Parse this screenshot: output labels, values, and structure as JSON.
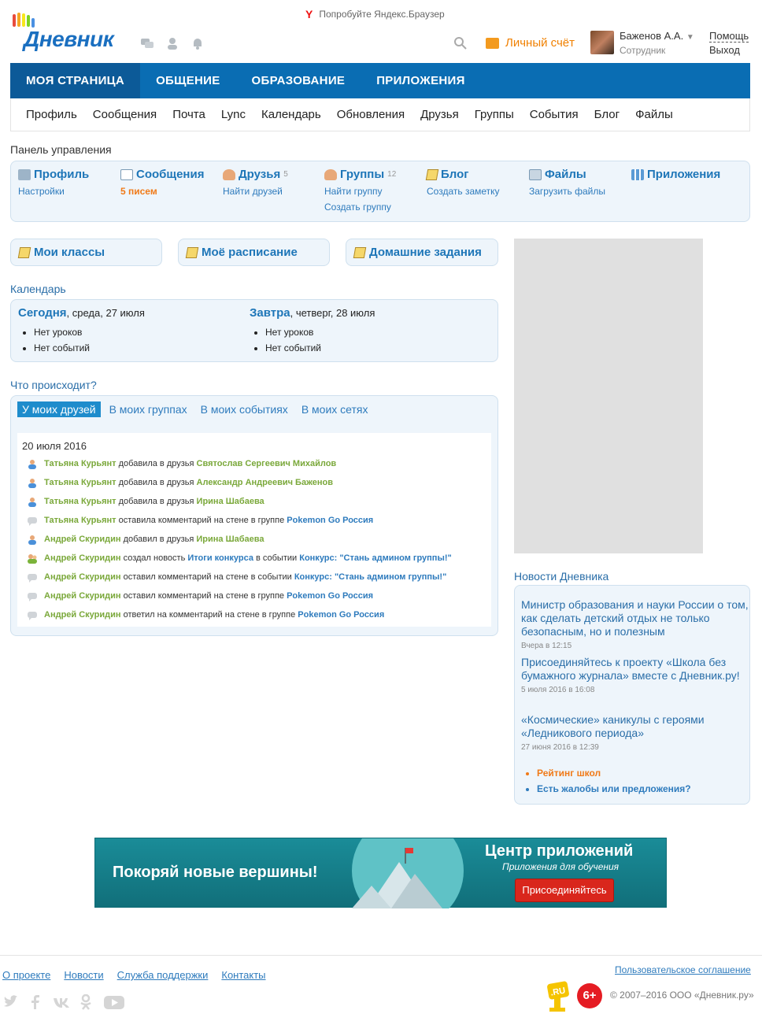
{
  "browser_promo": {
    "text": "Попробуйте Яндекс.Браузер"
  },
  "logo": {
    "text": "Дневник"
  },
  "header": {
    "account_label": "Личный счёт",
    "user_name": "Баженов А.А.",
    "user_role": "Сотрудник",
    "help": "Помощь",
    "exit": "Выход"
  },
  "main_nav": [
    "МОЯ СТРАНИЦА",
    "ОБЩЕНИЕ",
    "ОБРАЗОВАНИЕ",
    "ПРИЛОЖЕНИЯ"
  ],
  "sub_nav": [
    "Профиль",
    "Сообщения",
    "Почта",
    "Lync",
    "Календарь",
    "Обновления",
    "Друзья",
    "Группы",
    "События",
    "Блог",
    "Файлы"
  ],
  "control_panel": {
    "title": "Панель управления",
    "profile": {
      "title": "Профиль",
      "link": "Настройки"
    },
    "messages": {
      "title": "Сообщения",
      "link": "5 писем"
    },
    "friends": {
      "title": "Друзья",
      "count": "5",
      "link": "Найти друзей"
    },
    "groups": {
      "title": "Группы",
      "count": "12",
      "link1": "Найти группу",
      "link2": "Создать группу"
    },
    "blog": {
      "title": "Блог",
      "link": "Создать заметку"
    },
    "files": {
      "title": "Файлы",
      "link": "Загрузить файлы"
    },
    "apps": {
      "title": "Приложения"
    }
  },
  "quick_buttons": [
    "Мои классы",
    "Моё расписание",
    "Домашние задания"
  ],
  "calendar": {
    "title": "Календарь",
    "today": {
      "label": "Сегодня",
      "date": ", среда, 27 июля",
      "items": [
        "Нет уроков",
        "Нет событий"
      ]
    },
    "tomorrow": {
      "label": "Завтра",
      "date": ", четверг, 28 июля",
      "items": [
        "Нет уроков",
        "Нет событий"
      ]
    }
  },
  "activity": {
    "title": "Что происходит?",
    "tabs": [
      "У моих друзей",
      "В моих группах",
      "В моих событиях",
      "В моих сетях"
    ],
    "date": "20 июля 2016",
    "rows": [
      {
        "icon": "person-icon",
        "actor": "Татьяна Курьянт",
        "action": " добавила в друзья ",
        "target": "Святослав Сергеевич Михайлов",
        "extra": "",
        "target2": ""
      },
      {
        "icon": "person-icon",
        "actor": "Татьяна Курьянт",
        "action": " добавила в друзья ",
        "target": "Александр Андреевич Баженов",
        "extra": "",
        "target2": ""
      },
      {
        "icon": "person-icon",
        "actor": "Татьяна Курьянт",
        "action": " добавила в друзья ",
        "target": "Ирина Шабаева",
        "extra": "",
        "target2": ""
      },
      {
        "icon": "comment-icon",
        "actor": "Татьяна Курьянт",
        "action": " оставила комментарий на стене в группе ",
        "target": "Pokemon Go Россия",
        "extra": "",
        "target2": ""
      },
      {
        "icon": "person-icon",
        "actor": "Андрей Скуридин",
        "action": " добавил в друзья ",
        "target": "Ирина Шабаева",
        "extra": "",
        "target2": ""
      },
      {
        "icon": "group-icon",
        "actor": "Андрей Скуридин",
        "action": " создал новость ",
        "target": "Итоги конкурса",
        "extra": " в событии ",
        "target2": "Конкурс: \"Стань админом группы!\""
      },
      {
        "icon": "comment-icon",
        "actor": "Андрей Скуридин",
        "action": " оставил комментарий на стене в событии ",
        "target": "Конкурс: \"Стань админом группы!\"",
        "extra": "",
        "target2": ""
      },
      {
        "icon": "comment-icon",
        "actor": "Андрей Скуридин",
        "action": " оставил комментарий на стене в группе ",
        "target": "Pokemon Go Россия",
        "extra": "",
        "target2": ""
      },
      {
        "icon": "comment-icon",
        "actor": "Андрей Скуридин",
        "action": " ответил на комментарий на стене в группе ",
        "target": "Pokemon Go Россия",
        "extra": "",
        "target2": ""
      }
    ]
  },
  "news": {
    "title": "Новости Дневника",
    "items": [
      {
        "text": "Министр образования и науки России о том, как сделать детский отдых не только безопасным, но и полезным",
        "date": "Вчера в 12:15"
      },
      {
        "text": "Присоединяйтесь к проекту «Школа без бумажного журнала» вместе с Дневник.ру!",
        "date": "5 июля 2016 в 16:08"
      },
      {
        "text": "«Космические» каникулы с героями «Ледникового периода»",
        "date": "27 июня 2016 в 12:39"
      }
    ],
    "links": [
      "Рейтинг школ",
      "Есть жалобы или предложения?"
    ]
  },
  "banner": {
    "slogan": "Покоряй новые вершины!",
    "title": "Центр приложений",
    "subtitle": "Приложения для обучения",
    "button": "Присоединяйтесь"
  },
  "footer": {
    "links": [
      "О проекте",
      "Новости",
      "Служба поддержки",
      "Контакты"
    ],
    "agreement": "Пользовательское соглашение",
    "age": "6+",
    "copyright": "© 2007–2016 ООО «Дневник.ру»",
    "ru_mark": ".RU"
  },
  "colors": {
    "brand": "#0a6db3",
    "link": "#2e7bbd",
    "accent": "#f07a18",
    "green": "#7aa83a"
  }
}
